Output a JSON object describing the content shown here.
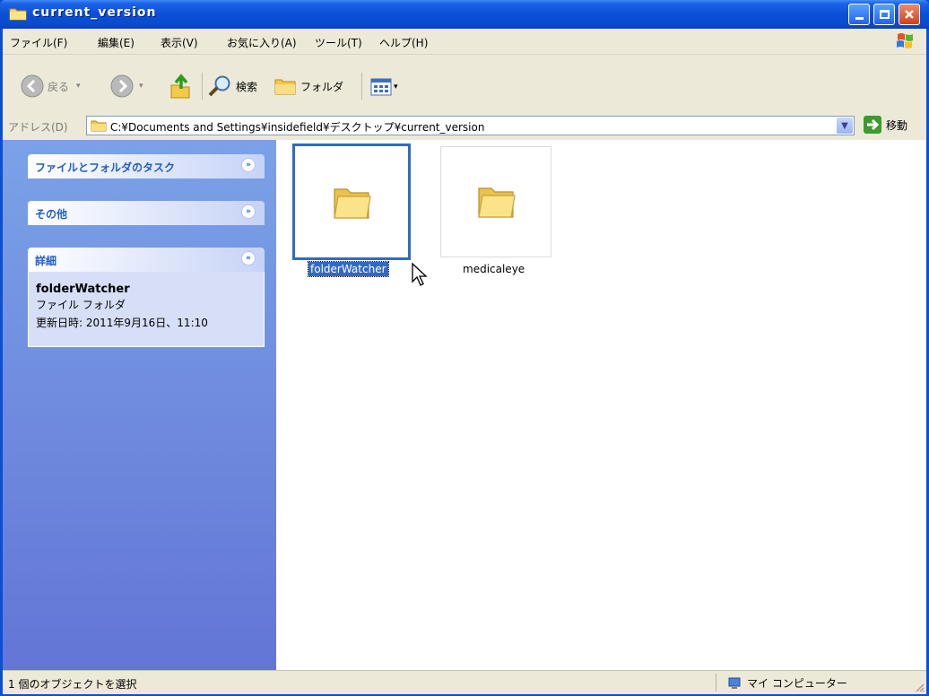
{
  "window": {
    "title": "current_version"
  },
  "menu": {
    "items": [
      "ファイル(F)",
      "編集(E)",
      "表示(V)",
      "お気に入り(A)",
      "ツール(T)",
      "ヘルプ(H)"
    ]
  },
  "toolbar": {
    "back_label": "戻る",
    "search_label": "検索",
    "folders_label": "フォルダ"
  },
  "address": {
    "label": "アドレス(D)",
    "value": "C:¥Documents and Settings¥insidefield¥デスクトップ¥current_version",
    "go_label": "移動"
  },
  "tasks": {
    "file_folder_tasks": "ファイルとフォルダのタスク",
    "other": "その他",
    "details": "詳細",
    "detail_name": "folderWatcher",
    "detail_type": "ファイル フォルダ",
    "detail_modified": "更新日時: 2011年9月16日、11:10"
  },
  "files": [
    {
      "name": "folderWatcher",
      "selected": true
    },
    {
      "name": "medicaleye",
      "selected": false
    }
  ],
  "status": {
    "selection": "1 個のオブジェクトを選択",
    "location": "マイ コンピューター"
  },
  "colors": {
    "title_blue": "#0a4fd6",
    "selection_blue": "#316ac5",
    "task_pane_top": "#7ba2e7",
    "task_pane_bottom": "#6375d6",
    "task_title": "#215dc6"
  }
}
